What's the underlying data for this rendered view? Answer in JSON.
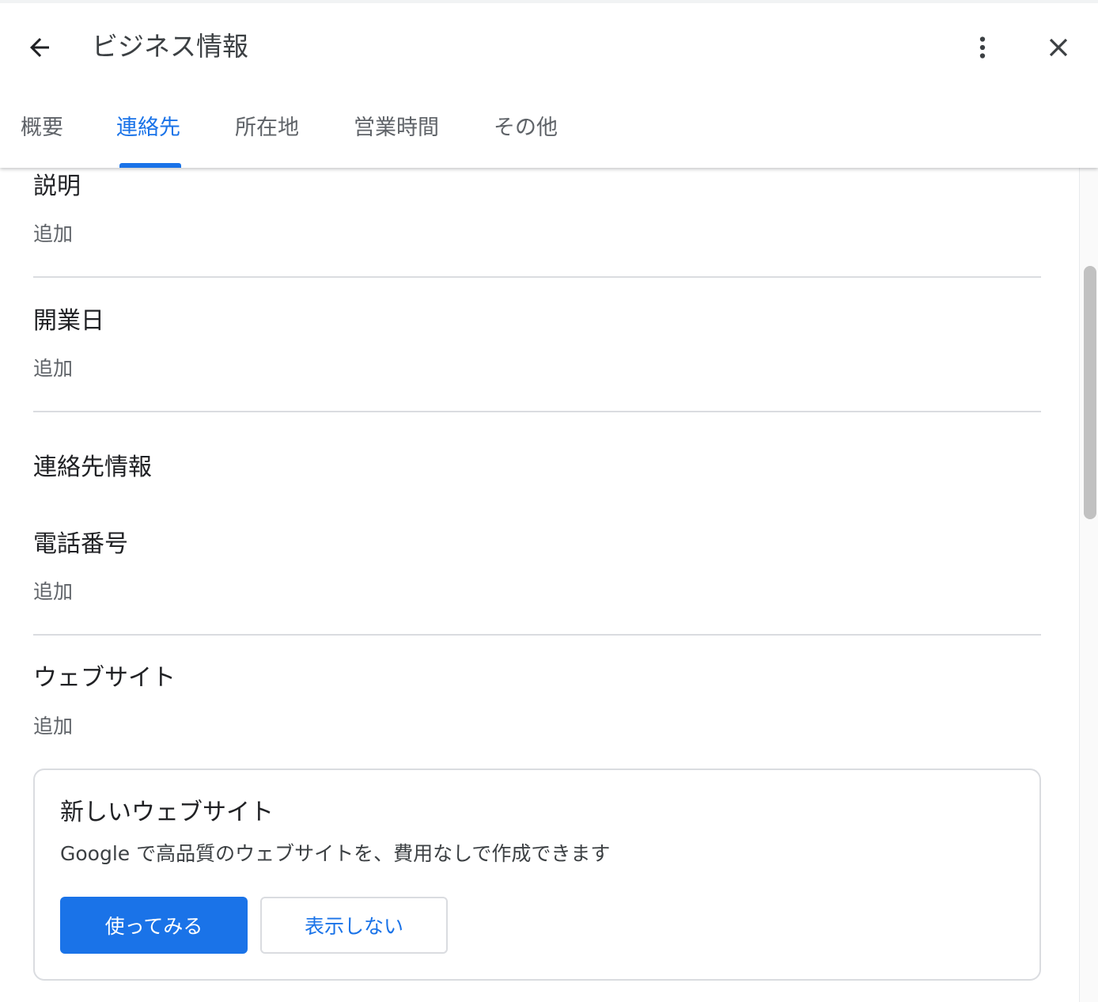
{
  "header": {
    "title": "ビジネス情報",
    "back_icon": "arrow-back-icon",
    "more_icon": "more-vert-icon",
    "close_icon": "close-icon"
  },
  "tabs": [
    {
      "label": "概要",
      "active": false
    },
    {
      "label": "連絡先",
      "active": true
    },
    {
      "label": "所在地",
      "active": false
    },
    {
      "label": "営業時間",
      "active": false
    },
    {
      "label": "その他",
      "active": false
    }
  ],
  "sections": {
    "description": {
      "label": "説明",
      "action": "追加"
    },
    "opening_date": {
      "label": "開業日",
      "action": "追加"
    },
    "contact_heading": "連絡先情報",
    "phone": {
      "label": "電話番号",
      "action": "追加"
    },
    "website": {
      "label": "ウェブサイト",
      "action": "追加"
    }
  },
  "promo_card": {
    "title": "新しいウェブサイト",
    "description": "Google で高品質のウェブサイトを、費用なしで作成できます",
    "primary_button": "使ってみる",
    "secondary_button": "表示しない"
  },
  "colors": {
    "accent": "#1a73e8",
    "text_primary": "#202124",
    "text_secondary": "#5f6368",
    "divider": "#dadce0"
  }
}
